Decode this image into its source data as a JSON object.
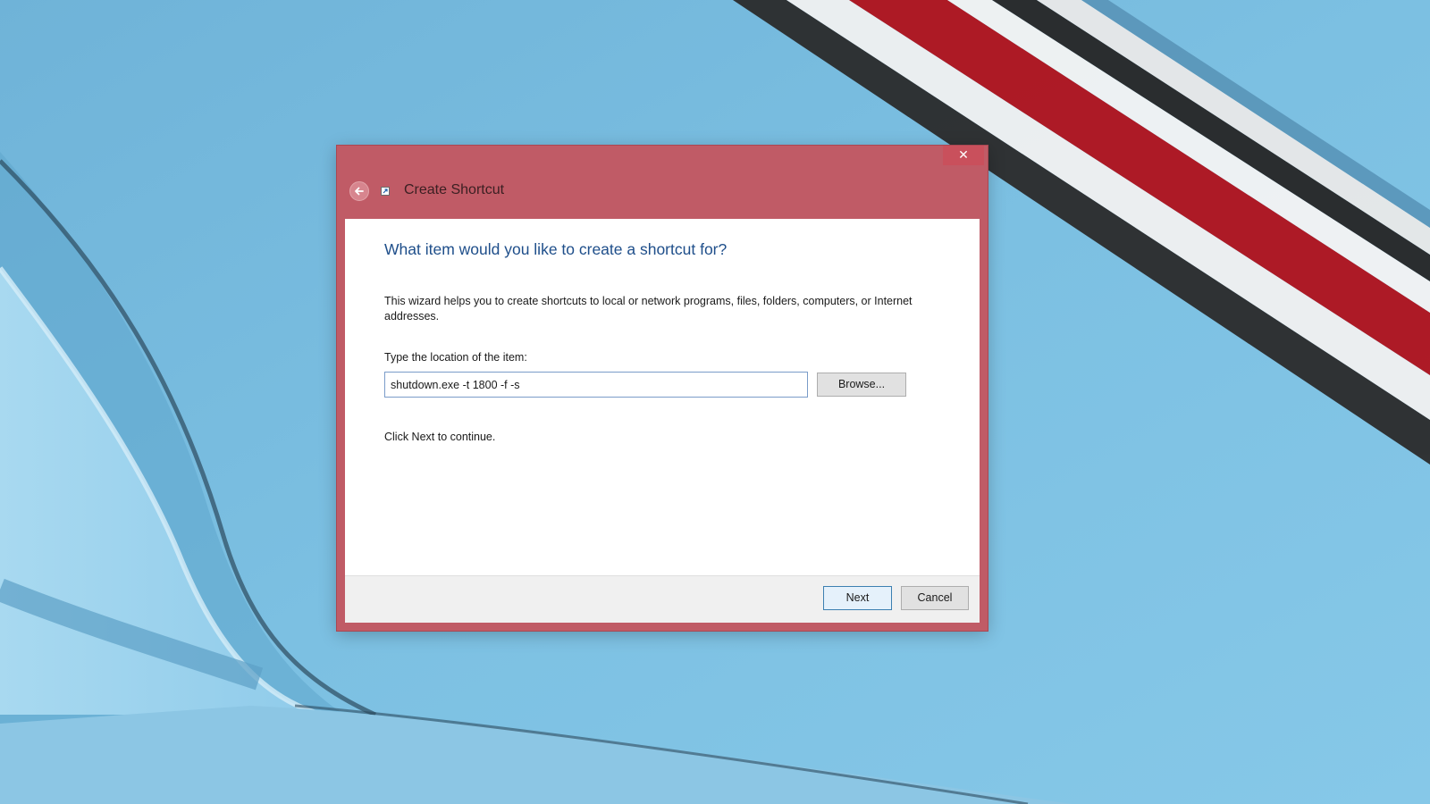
{
  "window": {
    "title": "Create Shortcut",
    "close_glyph": "✕",
    "back_icon": "back-arrow-icon",
    "app_icon": "shortcut-icon"
  },
  "wizard": {
    "heading": "What item would you like to create a shortcut for?",
    "description": "This wizard helps you to create shortcuts to local or network programs, files, folders, computers, or Internet addresses.",
    "location_label": "Type the location of the item:",
    "location_value": "shutdown.exe -t 1800 -f -s",
    "browse_label": "Browse...",
    "continue_text": "Click Next to continue."
  },
  "footer": {
    "next_label": "Next",
    "cancel_label": "Cancel"
  },
  "colors": {
    "window_frame": "#c05b66",
    "heading": "#1e4e8a",
    "desktop": "#78bcdf"
  }
}
